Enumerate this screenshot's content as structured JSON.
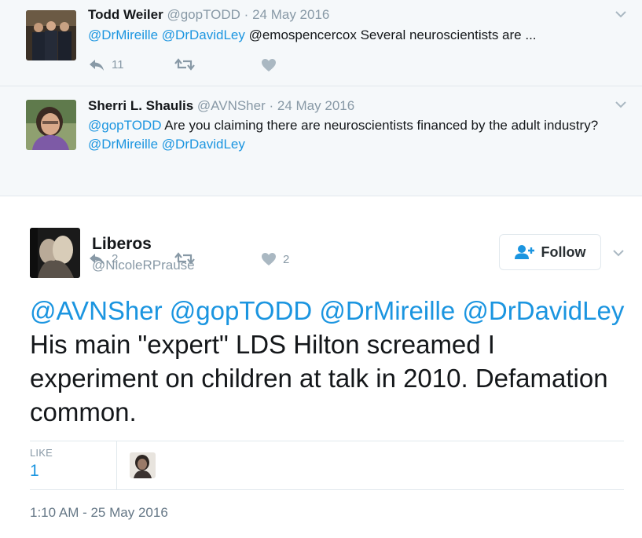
{
  "replies": [
    {
      "name": "Todd Weiler",
      "handle": "@gopTODD",
      "date": "24 May 2016",
      "mention1": "@DrMireille",
      "mention2": "@DrDavidLey",
      "text": "@emospencercox Several neuroscientists are ...",
      "reply_count": "11",
      "like_count": ""
    },
    {
      "name": "Sherri L. Shaulis",
      "handle": "@AVNSher",
      "date": "24 May 2016",
      "mention1": "@gopTODD",
      "text": "Are you claiming there are neuroscientists financed by the adult industry?",
      "mention2": "@DrMireille",
      "mention3": "@DrDavidLey",
      "reply_count": "2",
      "like_count": "2"
    }
  ],
  "separator": "·",
  "main_tweet": {
    "name": "Liberos",
    "handle": "@NicoleRPrause",
    "follow_label": "Follow",
    "mention1": "@AVNSher",
    "mention2": "@gopTODD",
    "mention3": "@DrMireille",
    "mention4": "@DrDavidLey",
    "text": "His main \"expert\" LDS Hilton screamed I experiment on children at talk in 2010. Defamation common.",
    "like_label": "LIKE",
    "like_count": "1",
    "timestamp": "1:10 AM - 25 May 2016"
  },
  "colors": {
    "link": "#1b95e0",
    "muted": "#8899a6",
    "reply_bg": "#f5f8fa"
  }
}
